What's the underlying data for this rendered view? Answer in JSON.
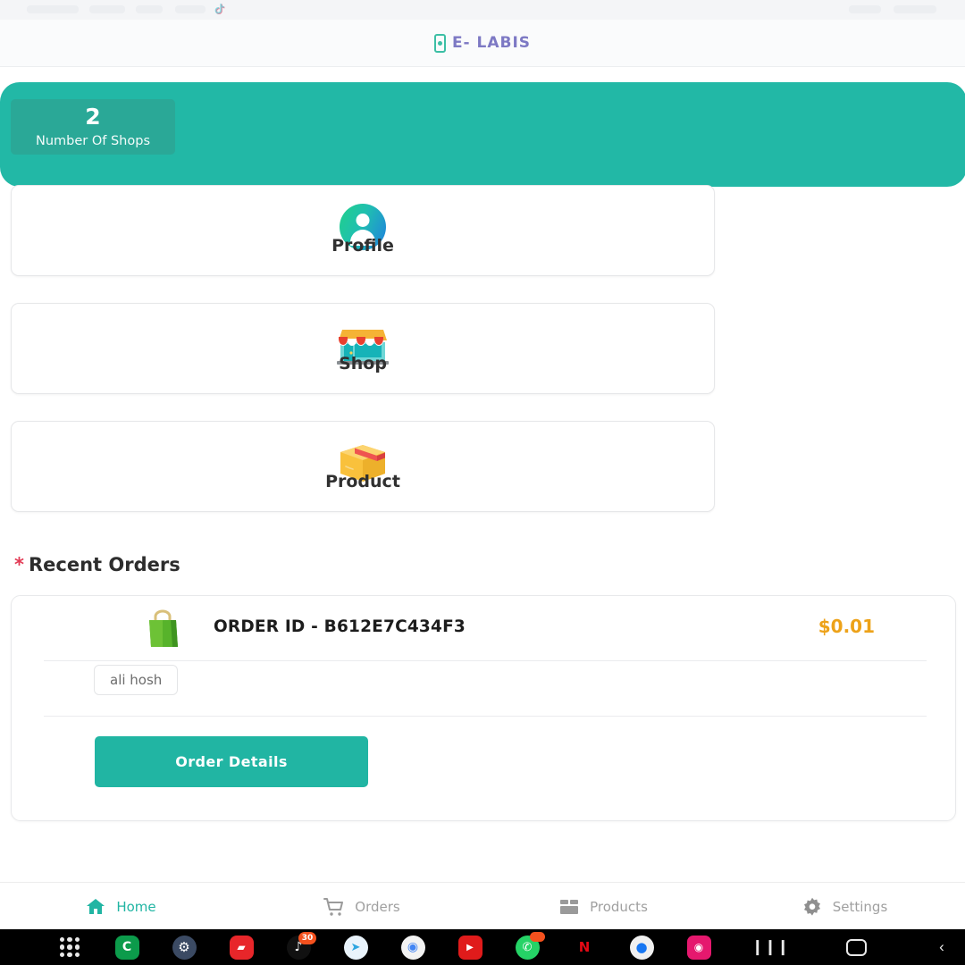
{
  "browser": {
    "tiktok_tab_icon": "tiktok-icon"
  },
  "appbar": {
    "logo_icon": "phone-icon",
    "title": "E- LABIS"
  },
  "hero": {
    "stat": {
      "value": "2",
      "label": "Number Of Shops"
    },
    "bg_color": "#22b8a6",
    "stat_bg_color": "#2aa897"
  },
  "menu_cards": [
    {
      "label": "Profile",
      "icon": "user-avatar-icon"
    },
    {
      "label": "Shop",
      "icon": "storefront-icon"
    },
    {
      "label": "Product",
      "icon": "package-box-icon"
    }
  ],
  "recent_orders": {
    "section_star": "*",
    "section_title": "Recent Orders",
    "order": {
      "bag_icon": "shopping-bag-icon",
      "order_id": "ORDER ID - B612E7C434F3",
      "price": "$0.01",
      "price_color": "#eda219",
      "customer": "ali hosh",
      "details_button": "Order Details",
      "details_button_color": "#21b5a3"
    }
  },
  "bottom_nav": {
    "active": "Home",
    "active_color": "#21b5a3",
    "inactive_color": "#a0a0a0",
    "items": [
      {
        "label": "Home",
        "icon": "home-icon"
      },
      {
        "label": "Orders",
        "icon": "shopping-cart-icon"
      },
      {
        "label": "Products",
        "icon": "boxes-icon"
      },
      {
        "label": "Settings",
        "icon": "gear-icon"
      }
    ]
  },
  "dock": {
    "apps": [
      {
        "name": "app-drawer-icon",
        "glyph": "",
        "bg": "",
        "badge": ""
      },
      {
        "name": "careem-icon",
        "glyph": "C",
        "bg": "#0c9b4b",
        "badge": ""
      },
      {
        "name": "settings-icon",
        "glyph": "⚙",
        "bg": "#3b4a63",
        "badge": ""
      },
      {
        "name": "chat-icon",
        "glyph": "💬",
        "bg": "#e8262a",
        "badge": ""
      },
      {
        "name": "tiktok-icon",
        "glyph": "♪",
        "bg": "#111111",
        "badge": "30"
      },
      {
        "name": "telegram-icon",
        "glyph": "➤",
        "bg": "#2ca5e0",
        "badge": ""
      },
      {
        "name": "chrome-icon",
        "glyph": "◉",
        "bg": "#f2f2f2",
        "badge": ""
      },
      {
        "name": "youtube-icon",
        "glyph": "▶",
        "bg": "#e01b1b",
        "badge": ""
      },
      {
        "name": "whatsapp-icon",
        "glyph": "✆",
        "bg": "#25d366",
        "badge": " "
      },
      {
        "name": "netflix-icon",
        "glyph": "N",
        "bg": "#000000",
        "badge": ""
      },
      {
        "name": "messenger-icon",
        "glyph": "●",
        "bg": "#f0f0f0",
        "badge": ""
      },
      {
        "name": "camera-icon",
        "glyph": "◉",
        "bg": "#e5186e",
        "badge": ""
      }
    ],
    "system": [
      {
        "name": "recents-button",
        "glyph": "❙❙❙"
      },
      {
        "name": "home-button",
        "glyph": ""
      },
      {
        "name": "back-button",
        "glyph": "‹"
      }
    ]
  }
}
